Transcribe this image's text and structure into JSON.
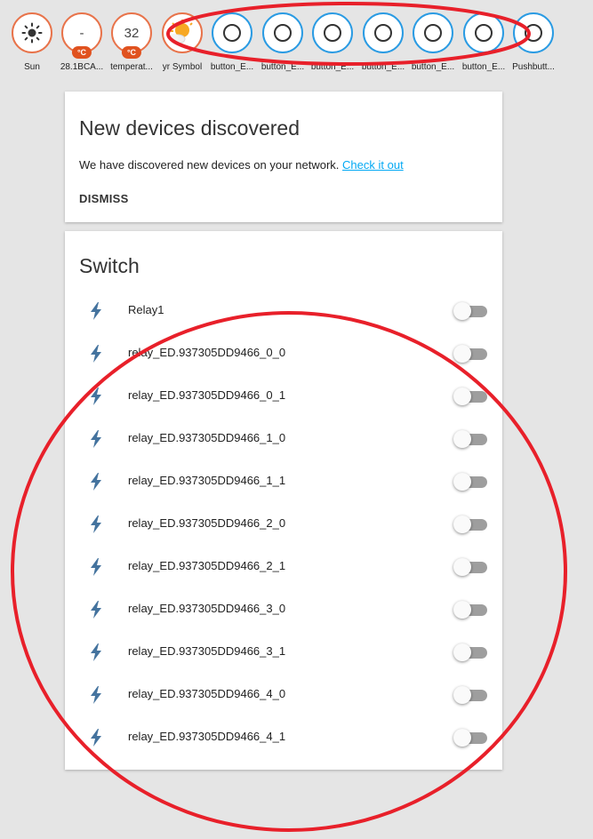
{
  "badges": [
    {
      "label": "Sun",
      "value": "",
      "unit": "",
      "icon": "sun-icon",
      "style": "orange"
    },
    {
      "label": "28.1BCA...",
      "value": "-",
      "unit": "°C",
      "icon": "",
      "style": "orange"
    },
    {
      "label": "temperat...",
      "value": "32",
      "unit": "°C",
      "icon": "",
      "style": "orange"
    },
    {
      "label": "yr Symbol",
      "value": "",
      "unit": "",
      "icon": "partly-sunny-icon",
      "style": "orange"
    },
    {
      "label": "button_E...",
      "value": "",
      "unit": "",
      "icon": "circle-outline-icon",
      "style": "blue"
    },
    {
      "label": "button_E...",
      "value": "",
      "unit": "",
      "icon": "circle-outline-icon",
      "style": "blue"
    },
    {
      "label": "button_E...",
      "value": "",
      "unit": "",
      "icon": "circle-outline-icon",
      "style": "blue"
    },
    {
      "label": "button_E...",
      "value": "",
      "unit": "",
      "icon": "circle-outline-icon",
      "style": "blue"
    },
    {
      "label": "button_E...",
      "value": "",
      "unit": "",
      "icon": "circle-outline-icon",
      "style": "blue"
    },
    {
      "label": "button_E...",
      "value": "",
      "unit": "",
      "icon": "circle-outline-icon",
      "style": "blue"
    },
    {
      "label": "Pushbutt...",
      "value": "",
      "unit": "",
      "icon": "circle-outline-icon",
      "style": "blue"
    }
  ],
  "discovery": {
    "title": "New devices discovered",
    "text": "We have discovered new devices on your network.",
    "link": "Check it out",
    "dismiss": "DISMISS"
  },
  "switch_card": {
    "title": "Switch",
    "items": [
      {
        "name": "Relay1",
        "state": "off"
      },
      {
        "name": "relay_ED.937305DD9466_0_0",
        "state": "off"
      },
      {
        "name": "relay_ED.937305DD9466_0_1",
        "state": "off"
      },
      {
        "name": "relay_ED.937305DD9466_1_0",
        "state": "off"
      },
      {
        "name": "relay_ED.937305DD9466_1_1",
        "state": "off"
      },
      {
        "name": "relay_ED.937305DD9466_2_0",
        "state": "off"
      },
      {
        "name": "relay_ED.937305DD9466_2_1",
        "state": "off"
      },
      {
        "name": "relay_ED.937305DD9466_3_0",
        "state": "off"
      },
      {
        "name": "relay_ED.937305DD9466_3_1",
        "state": "off"
      },
      {
        "name": "relay_ED.937305DD9466_4_0",
        "state": "off"
      },
      {
        "name": "relay_ED.937305DD9466_4_1",
        "state": "off"
      }
    ]
  },
  "colors": {
    "badge_orange": "#e8734a",
    "badge_blue": "#2a9be3",
    "unit_pill": "#e0521f",
    "bolt": "#44739e",
    "link": "#03a9f4",
    "annotation": "#e8202a"
  }
}
